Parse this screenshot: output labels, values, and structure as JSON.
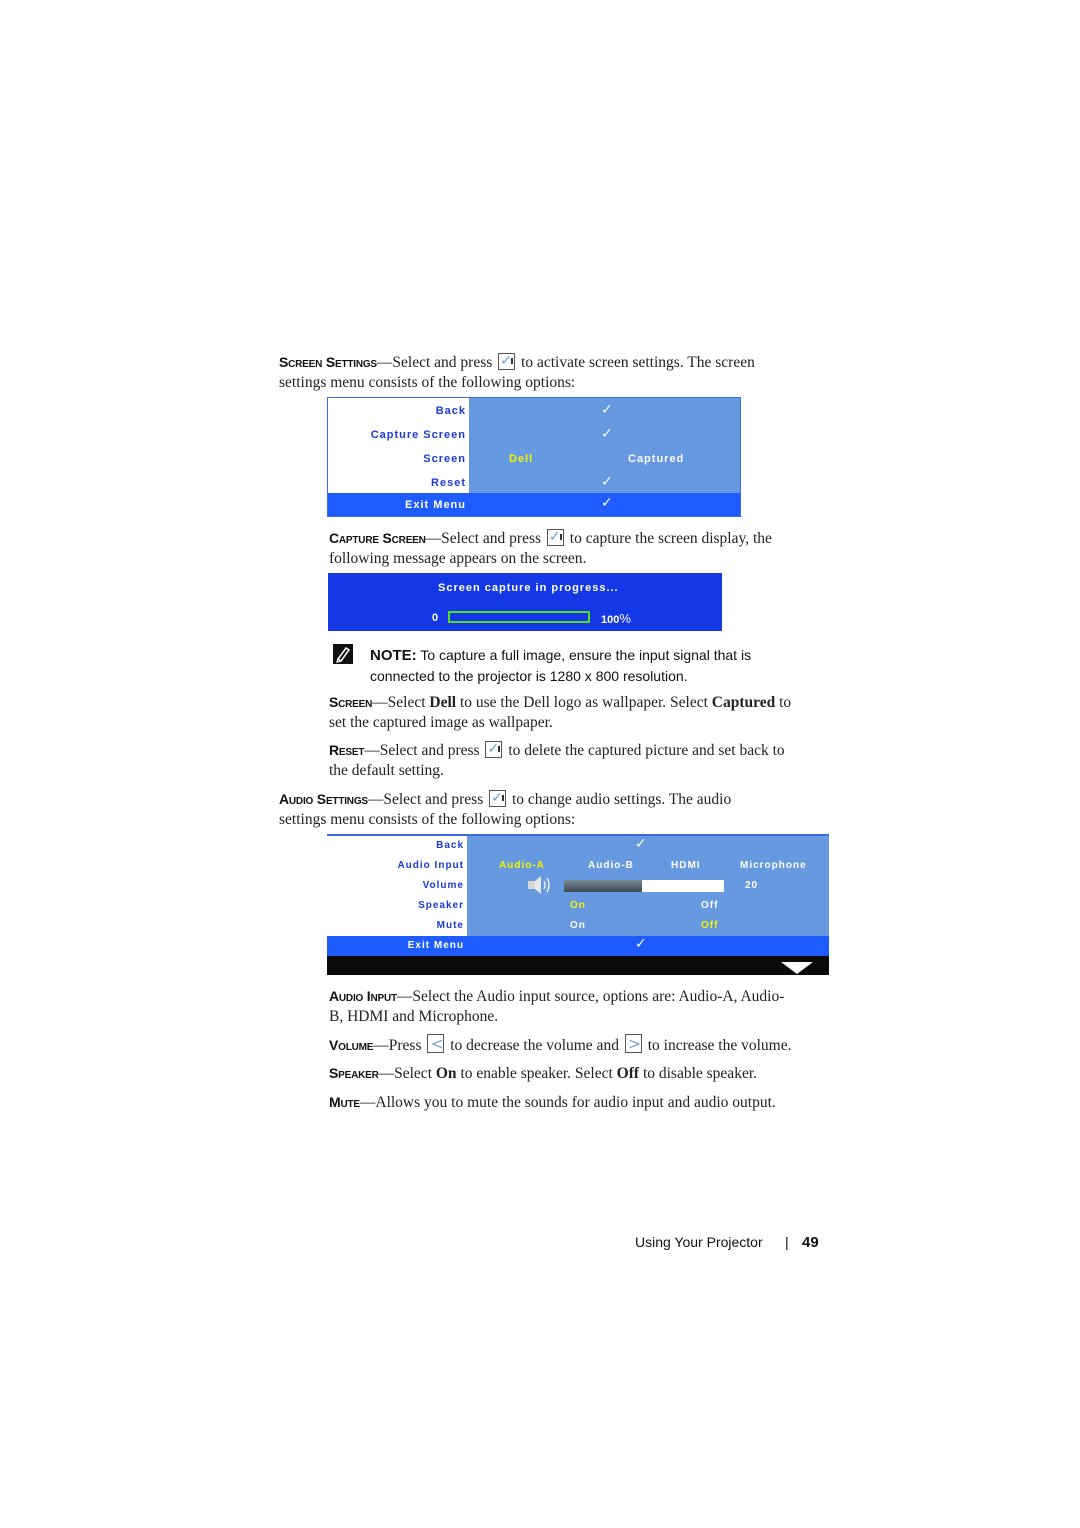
{
  "screen_settings": {
    "lead": "Screen Settings",
    "text_before": "—Select and press",
    "text_after": "to activate screen settings. The screen",
    "line2": "settings menu consists of the following options:",
    "press_icon": "check-button-icon"
  },
  "screen_menu": {
    "rows": [
      {
        "label": "Back",
        "value": "check"
      },
      {
        "label": "Capture Screen",
        "value": "check"
      },
      {
        "label": "Screen",
        "options": [
          "Dell",
          "Captured"
        ],
        "selected": "Dell"
      },
      {
        "label": "Reset",
        "value": "check"
      }
    ],
    "exit_label": "Exit Menu"
  },
  "capture_screen": {
    "lead": "Capture Screen",
    "text_before": "—Select and press",
    "text_after": "to capture the screen display, the",
    "line2": "following message appears on the screen."
  },
  "capture_progress": {
    "title": "Screen capture in progress...",
    "min_label": "0",
    "max_label": "100",
    "max_unit": "%",
    "progress_percent": 0
  },
  "note": {
    "label": "NOTE:",
    "text": "To capture a full image, ensure the input signal that is",
    "line2": "connected to the projector is 1280 x 800 resolution.",
    "icon": "note-pencil-icon"
  },
  "screen_desc": {
    "lead": "Screen",
    "t1": "—Select ",
    "dell": "Dell",
    "t2": " to use the Dell logo as wallpaper. Select ",
    "captured": "Captured",
    "t3": " to",
    "line2": "set the captured image as wallpaper."
  },
  "reset_desc": {
    "lead": "Reset",
    "text_before": "—Select and press",
    "text_after": "to delete the captured picture and set back to",
    "line2": "the default setting."
  },
  "audio_settings": {
    "lead": "Audio Settings",
    "text_before": "—Select and press",
    "text_after": "to change audio settings. The audio",
    "line2": "settings menu consists of the following options:"
  },
  "audio_menu": {
    "back_label": "Back",
    "audio_input_label": "Audio Input",
    "audio_input_options": [
      "Audio-A",
      "Audio-B",
      "HDMI",
      "Microphone"
    ],
    "audio_input_selected": "Audio-A",
    "volume_label": "Volume",
    "volume_value": "20",
    "volume_fill_fraction": 0.49,
    "speaker_label": "Speaker",
    "speaker_options": [
      "On",
      "Off"
    ],
    "speaker_selected": "On",
    "mute_label": "Mute",
    "mute_options": [
      "On",
      "Off"
    ],
    "mute_selected": "Off",
    "exit_label": "Exit Menu"
  },
  "audio_input_desc": {
    "lead": "Audio Input",
    "text": "—Select the Audio input source, options are: Audio-A, Audio-",
    "line2": "B, HDMI and Microphone."
  },
  "volume_desc": {
    "lead": "Volume",
    "t1": "—Press",
    "t2": "to decrease the volume and",
    "t3": "to increase the volume.",
    "left_key": "<",
    "right_key": ">"
  },
  "speaker_desc": {
    "lead": "Speaker",
    "t1": "—Select ",
    "on": "On",
    "t2": " to enable speaker. Select ",
    "off": "Off",
    "t3": " to disable speaker."
  },
  "mute_desc": {
    "lead": "Mute",
    "text": "—Allows you to mute the sounds for audio input and audio output."
  },
  "footer": {
    "section": "Using Your Projector",
    "separator": "|",
    "page_number": "49"
  },
  "colors": {
    "osd_label_text": "#1a3ad6",
    "osd_value_bg": "#6699e0",
    "osd_exit_bg": "#1f5cff",
    "osd_selected": "#f4f400",
    "progress_bg": "#1538e6",
    "progress_border": "#50e020"
  }
}
